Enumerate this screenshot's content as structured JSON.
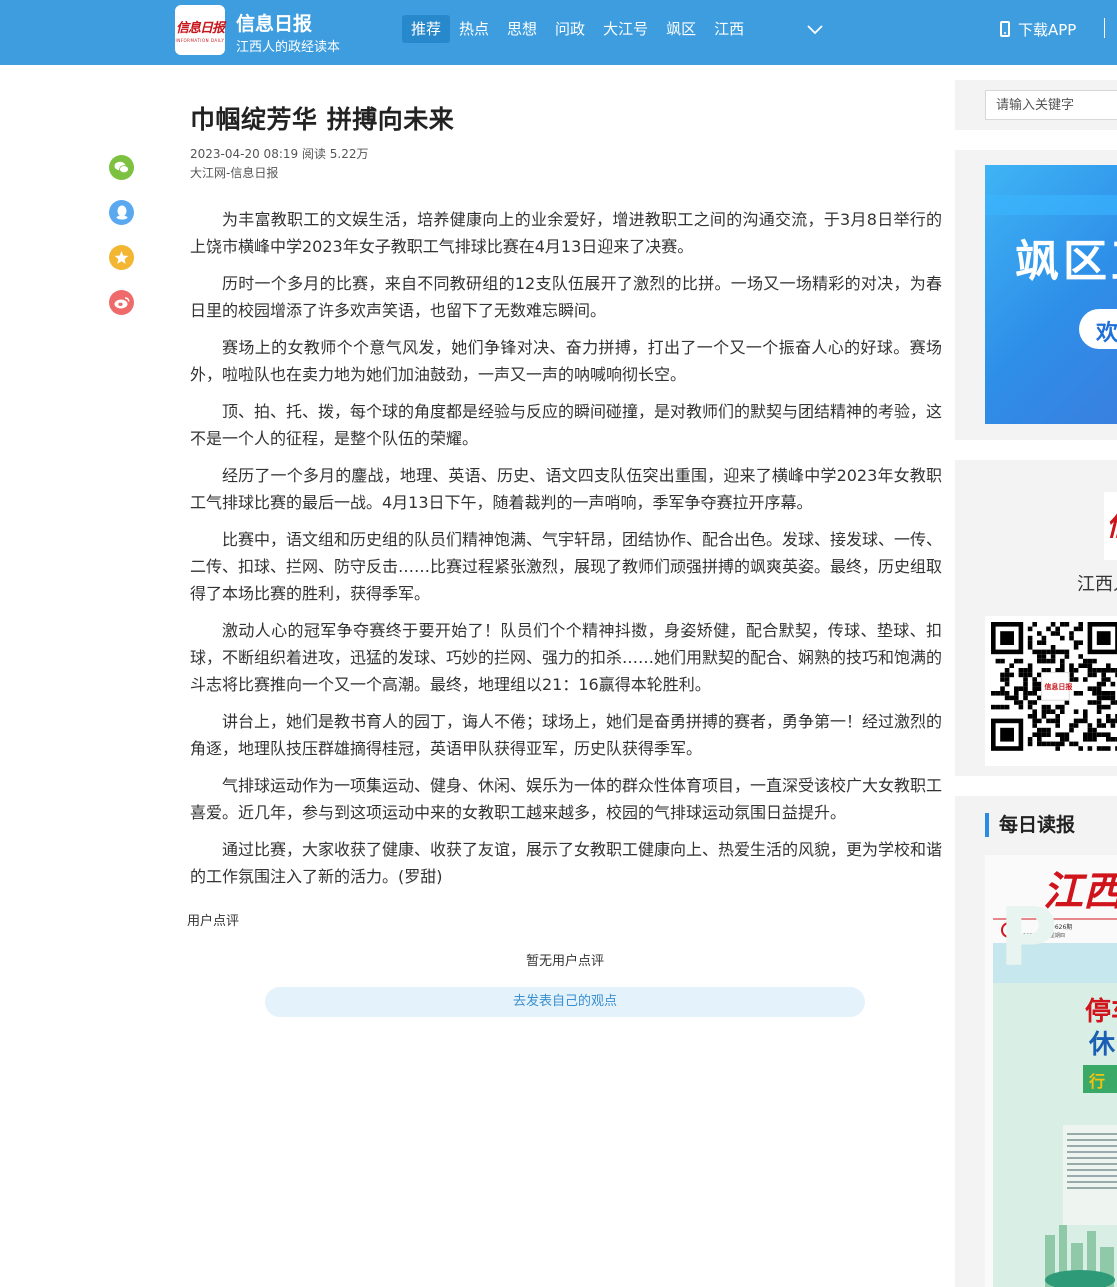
{
  "header": {
    "logo_text": "信息日报",
    "logo_subtext": "INFORMATION DAILY",
    "brand_name": "信息日报",
    "slogan": "江西人的政经读本",
    "nav": [
      {
        "label": "推荐",
        "active": true
      },
      {
        "label": "热点",
        "active": false
      },
      {
        "label": "思想",
        "active": false
      },
      {
        "label": "问政",
        "active": false
      },
      {
        "label": "大江号",
        "active": false
      },
      {
        "label": "飒区",
        "active": false
      },
      {
        "label": "江西",
        "active": false
      }
    ],
    "download_label": "下载APP"
  },
  "share_icons": [
    {
      "name": "wechat-icon",
      "color": "#7cc13f"
    },
    {
      "name": "qq-icon",
      "color": "#5aa8f0"
    },
    {
      "name": "qzone-icon",
      "color": "#f2b632"
    },
    {
      "name": "weibo-icon",
      "color": "#ef6b6b"
    }
  ],
  "article": {
    "title": "巾帼绽芳华 拼搏向未来",
    "meta": "2023-04-20 08:19 阅读 5.22万",
    "source": "大江网-信息日报",
    "paragraphs": [
      "为丰富教职工的文娱生活，培养健康向上的业余爱好，增进教职工之间的沟通交流，于3月8日举行的上饶市横峰中学2023年女子教职工气排球比赛在4月13日迎来了决赛。",
      "历时一个多月的比赛，来自不同教研组的12支队伍展开了激烈的比拼。一场又一场精彩的对决，为春日里的校园增添了许多欢声笑语，也留下了无数难忘瞬间。",
      "赛场上的女教师个个意气风发，她们争锋对决、奋力拼搏，打出了一个又一个振奋人心的好球。赛场外，啦啦队也在卖力地为她们加油鼓劲，一声又一声的呐喊响彻长空。",
      "顶、拍、托、拨，每个球的角度都是经验与反应的瞬间碰撞，是对教师们的默契与团结精神的考验，这不是一个人的征程，是整个队伍的荣耀。",
      "经历了一个多月的鏖战，地理、英语、历史、语文四支队伍突出重围，迎来了横峰中学2023年女教职工气排球比赛的最后一战。4月13日下午，随着裁判的一声哨响，季军争夺赛拉开序幕。",
      "比赛中，语文组和历史组的队员们精神饱满、气宇轩昂，团结协作、配合出色。发球、接发球、一传、二传、扣球、拦网、防守反击……比赛过程紧张激烈，展现了教师们顽强拼搏的飒爽英姿。最终，历史组取得了本场比赛的胜利，获得季军。",
      "激动人心的冠军争夺赛终于要开始了！队员们个个精神抖擞，身姿矫健，配合默契，传球、垫球、扣球，不断组织着进攻，迅猛的发球、巧妙的拦网、强力的扣杀……她们用默契的配合、娴熟的技巧和饱满的斗志将比赛推向一个又一个高潮。最终，地理组以21：16赢得本轮胜利。",
      "讲台上，她们是教书育人的园丁，诲人不倦；球场上，她们是奋勇拼搏的赛者，勇争第一！经过激烈的角逐，地理队技压群雄摘得桂冠，英语甲队获得亚军，历史队获得季军。",
      "气排球运动作为一项集运动、健身、休闲、娱乐为一体的群众性体育项目，一直深受该校广大女教职工喜爱。近几年，参与到这项运动中来的女教职工越来越多，校园的气排球运动氛围日益提升。",
      "通过比赛，大家收获了健康、收获了友谊，展示了女教职工健康向上、热爱生活的风貌，更为学校和谐的工作氛围注入了新的活力。(罗甜)"
    ]
  },
  "comments": {
    "title": "用户点评",
    "empty_text": "暂无用户点评",
    "post_button": "去发表自己的观点"
  },
  "sidebar": {
    "search_placeholder": "请输入关键字",
    "banner_text": "飒区正",
    "banner_button": "欢",
    "app_logo_text": "信",
    "app_name": "江西人",
    "daily_title": "每日读报",
    "paper": {
      "masthead": "江西",
      "issue": "第9626期",
      "date": "2023.4.20 星期四",
      "headline_1": "停车",
      "headline_2": "休",
      "badge": "行"
    }
  }
}
